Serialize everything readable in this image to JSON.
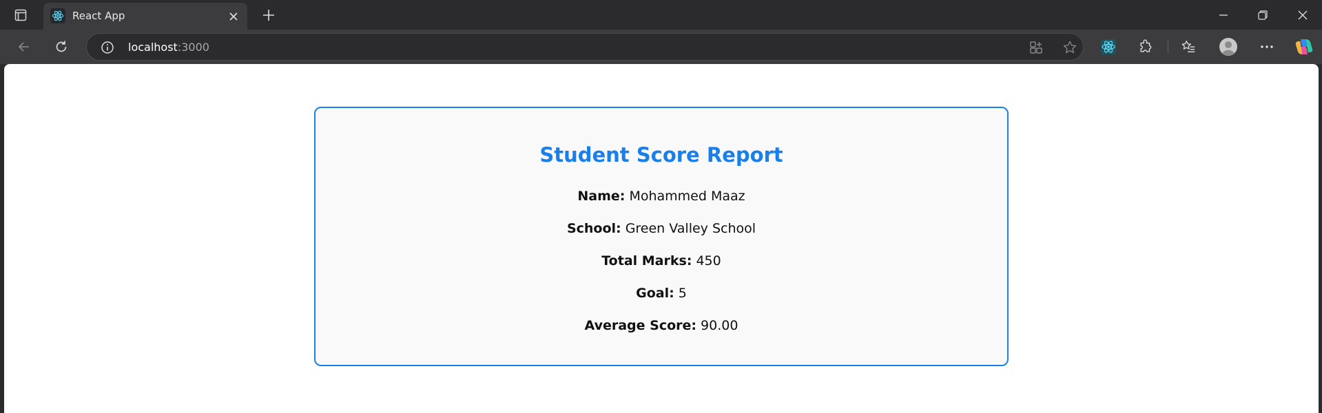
{
  "browser": {
    "tab": {
      "title": "React App"
    },
    "address": {
      "host": "localhost",
      "port": ":3000"
    }
  },
  "icons": {
    "tab_actions": "tab-actions-icon",
    "favicon": "react-atom-icon",
    "close": "close-icon",
    "new_tab": "plus-icon",
    "back": "arrow-left-icon",
    "reload": "reload-icon",
    "info": "info-icon",
    "apps": "apps-icon",
    "favorite": "star-icon",
    "extension_active": "react-devtools-icon",
    "extensions": "puzzle-icon",
    "favorites": "favorites-icon",
    "profile": "avatar-icon",
    "menu": "more-icon",
    "copilot": "copilot-icon"
  },
  "report": {
    "title": "Student Score Report",
    "fields": [
      {
        "label": "Name:",
        "value": "Mohammed Maaz"
      },
      {
        "label": "School:",
        "value": "Green Valley School"
      },
      {
        "label": "Total Marks:",
        "value": "450"
      },
      {
        "label": "Goal:",
        "value": "5"
      },
      {
        "label": "Average Score:",
        "value": "90.00"
      }
    ]
  },
  "colors": {
    "accent": "#1a7fe8",
    "card_background": "#f9f9f9",
    "chrome_dark": "#2b2b2e",
    "chrome_toolbar": "#3c3c3f"
  }
}
